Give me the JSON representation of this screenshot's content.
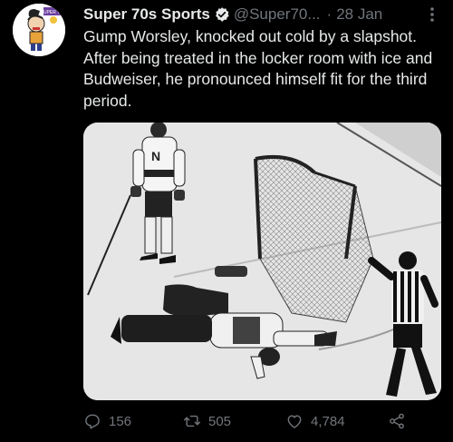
{
  "tweet": {
    "display_name": "Super 70s Sports",
    "handle": "@Super70...",
    "separator": "·",
    "date": "28 Jan",
    "text": "Gump Worsley, knocked out cold by a slapshot. After being treated in the locker room with ice and Budweiser, he pronounced himself fit for the third period.",
    "avatar_text": "SUPER 70s"
  },
  "actions": {
    "replies": "156",
    "retweets": "505",
    "likes": "4,784"
  },
  "icons": {
    "verified": "verified-badge-icon",
    "more": "more-vertical-icon",
    "reply": "reply-icon",
    "retweet": "retweet-icon",
    "like": "heart-icon",
    "share": "share-icon"
  },
  "colors": {
    "background": "#000000",
    "text": "#e7e9ea",
    "muted": "#71767b"
  }
}
